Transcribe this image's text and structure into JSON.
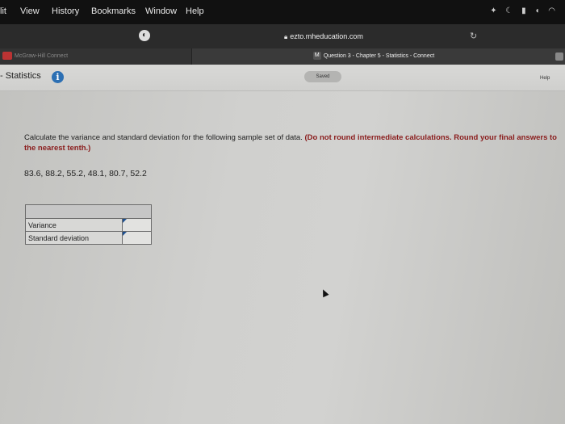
{
  "menubar": {
    "items": [
      "lit",
      "View",
      "History",
      "Bookmarks",
      "Window",
      "Help"
    ]
  },
  "browser": {
    "url": "ezto.mheducation.com"
  },
  "tabs": {
    "tab1_label": "McGraw-Hill Connect",
    "tab2_label": "Question 3 - Chapter 5 - Statistics - Connect",
    "tab2_favicon": "M"
  },
  "header": {
    "title": "- Statistics",
    "info_glyph": "i",
    "saved_label": "Saved",
    "help_label": "Help"
  },
  "question": {
    "prompt": "Calculate the variance and standard deviation for the following sample set of data. ",
    "note": "(Do not round intermediate calculations. Round your final answers to the nearest tenth.)",
    "dataset": "83.6, 88.2, 55.2, 48.1, 80.7, 52.2"
  },
  "answers": {
    "rows": [
      {
        "label": "Variance",
        "value": ""
      },
      {
        "label": "Standard deviation",
        "value": ""
      }
    ]
  },
  "colors": {
    "accent": "#2c6fb3",
    "note": "#8a1c1c"
  }
}
